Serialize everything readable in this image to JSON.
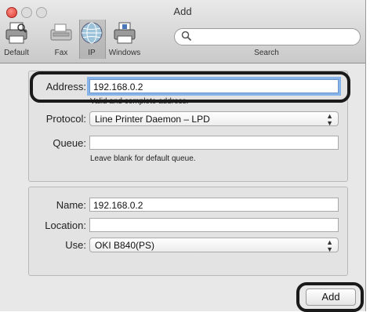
{
  "window": {
    "title": "Add"
  },
  "toolbar": {
    "default_label": "Default",
    "fax_label": "Fax",
    "ip_label": "IP",
    "windows_label": "Windows",
    "search_label": "Search",
    "search_value": ""
  },
  "form1": {
    "address_label": "Address:",
    "address_value": "192.168.0.2",
    "address_hint": "Valid and complete address.",
    "protocol_label": "Protocol:",
    "protocol_value": "Line Printer Daemon – LPD",
    "queue_label": "Queue:",
    "queue_value": "",
    "queue_hint": "Leave blank for default queue."
  },
  "form2": {
    "name_label": "Name:",
    "name_value": "192.168.0.2",
    "location_label": "Location:",
    "location_value": "",
    "use_label": "Use:",
    "use_value": "OKI B840(PS)"
  },
  "actions": {
    "add_label": "Add"
  },
  "colors": {
    "focus_ring": "#86b3e8",
    "close_button": "#d9362c",
    "highlight_oval": "#1a1a1a"
  }
}
